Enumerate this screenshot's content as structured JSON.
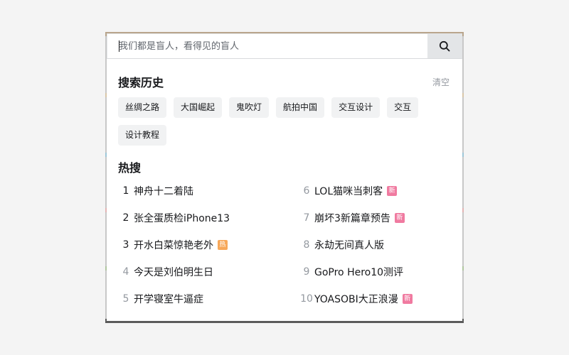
{
  "search": {
    "placeholder": "我们都是盲人，看得见的盲人",
    "button_icon": "search-icon"
  },
  "history": {
    "title": "搜索历史",
    "clear_label": "清空",
    "tags": [
      "丝绸之路",
      "大国崛起",
      "鬼吹灯",
      "航拍中国",
      "交互设计",
      "交互",
      "设计教程"
    ]
  },
  "trending": {
    "title": "热搜",
    "items": [
      {
        "rank": "1",
        "text": "神舟十二着陆",
        "badge": ""
      },
      {
        "rank": "6",
        "text": "LOL猫咪当刺客",
        "badge": "新"
      },
      {
        "rank": "2",
        "text": "张全蛋质检iPhone13",
        "badge": ""
      },
      {
        "rank": "7",
        "text": "崩坏3新篇章预告",
        "badge": "新"
      },
      {
        "rank": "3",
        "text": "开水白菜惊艳老外",
        "badge": "热"
      },
      {
        "rank": "8",
        "text": "永劫无间真人版",
        "badge": ""
      },
      {
        "rank": "4",
        "text": "今天是刘伯明生日",
        "badge": ""
      },
      {
        "rank": "9",
        "text": "GoPro Hero10测评",
        "badge": ""
      },
      {
        "rank": "5",
        "text": "开学寝室牛逼症",
        "badge": ""
      },
      {
        "rank": "10",
        "text": "YOASOBI大正浪漫",
        "badge": "新"
      }
    ]
  },
  "colors": {
    "new_badge": "#f07aa0",
    "hot_badge": "#f7a85a",
    "top_rank": "#18191c",
    "other_rank": "#9499a0"
  }
}
